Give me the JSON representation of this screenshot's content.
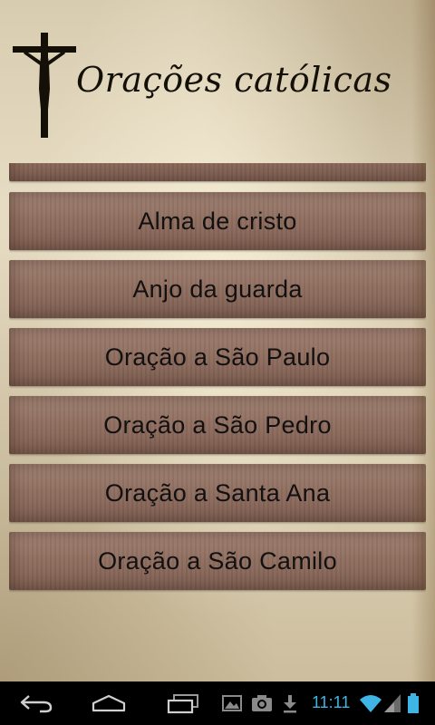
{
  "app": {
    "title": "Orações católicas",
    "logo_icon": "crucifix-icon"
  },
  "prayers": {
    "partial_item": {
      "label": ""
    },
    "items": [
      {
        "label": "Alma de cristo"
      },
      {
        "label": "Anjo da guarda"
      },
      {
        "label": "Oração a São Paulo"
      },
      {
        "label": "Oração a São Pedro"
      },
      {
        "label": "Oração a Santa Ana"
      },
      {
        "label": "Oração a São Camilo"
      }
    ]
  },
  "system_bar": {
    "back_icon": "back-icon",
    "home_icon": "home-icon",
    "recents_icon": "recent-apps-icon",
    "notifications": [
      "gallery-icon",
      "camera-icon",
      "download-icon"
    ],
    "time": "11:11",
    "wifi_icon": "wifi-icon",
    "signal_icon": "signal-icon",
    "battery_icon": "battery-icon",
    "accent_color": "#3fb5e6"
  },
  "colors": {
    "parchment": "#e2d7bd",
    "list_item": "#8f6e5f",
    "text": "#121010"
  }
}
